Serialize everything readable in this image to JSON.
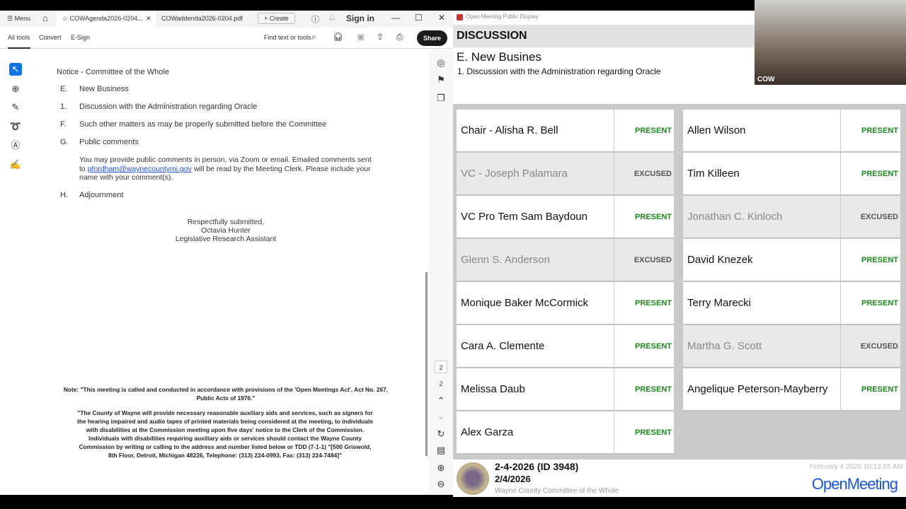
{
  "acrobat": {
    "tabs": {
      "menu": "Menu",
      "active": "COWAgenda2026-0204...",
      "second": "COWaddenda2026-0204.pdf",
      "create": "Create",
      "signin": "Sign in"
    },
    "toolbar": {
      "all_tools": "All tools",
      "convert": "Convert",
      "esign": "E-Sign",
      "find": "Find text or tools",
      "share": "Share"
    },
    "page_nums": [
      "2",
      "2"
    ],
    "doc": {
      "notice": "Notice - Committee of the Whole",
      "items": [
        {
          "letter": "E.",
          "text": "New Business"
        },
        {
          "letter": "1.",
          "text": "Discussion with the Administration regarding Oracle"
        },
        {
          "letter": "F.",
          "text": "Such other matters as may be properly submitted before the Committee"
        },
        {
          "letter": "G.",
          "text": "Public comments"
        }
      ],
      "public_1": "You may provide public comments in person, via Zoom or email. Emailed comments sent",
      "public_2a": "to ",
      "email": "pfordham@waynecountymi.gov",
      "public_2b": " will be read by the Meeting Clerk. Please include your",
      "public_3": "name with your comment(s).",
      "h_letter": "H.",
      "h_text": "Adjournment",
      "sig": [
        "Respectfully submitted,",
        "Octavia Hunter",
        "Legislative Research Assistant"
      ],
      "note": "Note: \"This meeting is called and conducted in accordance with provisions of the 'Open Meetings Act', Act No. 267, Public Acts of 1976.\"",
      "ada": "\"The County of Wayne will provide necessary reasonable auxiliary aids and services, such as signers for the hearing impaired and audio tapes of printed materials being considered at the meeting, to individuals with disabilities at the Commission meeting upon five days' notice to the Clerk of the Commission. Individuals with disabilities requiring auxiliary aids or services should contact the Wayne County Commission by writing or calling to the address and number listed below or TDD (7-1-1) \"[500 Griswold, 8th Floor, Detroit, Michigan 48226, Telephone: (313) 224-0993, Fax: (313) 224-7484]\""
    }
  },
  "display": {
    "window_title": "Open Meeting Public Display",
    "section": "DISCUSSION",
    "heading": "E. New Busines",
    "item": "1. Discussion with the Administration regarding Oracle",
    "left": [
      {
        "name": "Chair - Alisha R. Bell",
        "status": "PRESENT"
      },
      {
        "name": "VC - Joseph Palamara",
        "status": "EXCUSED"
      },
      {
        "name": "VC Pro Tem Sam Baydoun",
        "status": "PRESENT"
      },
      {
        "name": "Glenn S. Anderson",
        "status": "EXCUSED"
      },
      {
        "name": "Monique Baker McCormick",
        "status": "PRESENT"
      },
      {
        "name": "Cara A. Clemente",
        "status": "PRESENT"
      },
      {
        "name": "Melissa Daub",
        "status": "PRESENT"
      },
      {
        "name": "Alex Garza",
        "status": "PRESENT"
      }
    ],
    "right": [
      {
        "name": "Allen Wilson",
        "status": "PRESENT"
      },
      {
        "name": "Tim Killeen",
        "status": "PRESENT"
      },
      {
        "name": "Jonathan C. Kinloch",
        "status": "EXCUSED"
      },
      {
        "name": "David  Knezek",
        "status": "PRESENT"
      },
      {
        "name": "Terry Marecki",
        "status": "PRESENT"
      },
      {
        "name": "Martha G. Scott",
        "status": "EXCUSED"
      },
      {
        "name": "Angelique Peterson-Mayberry",
        "status": "PRESENT"
      }
    ],
    "footer": {
      "meeting": "2-4-2026 (ID 3948)",
      "date": "2/4/2026",
      "body": "Wayne County Committee of the Whole",
      "timestamp": "February 4 2026 10:13:55 AM",
      "brand": "OpenMeeting"
    },
    "video_label": "COW"
  }
}
